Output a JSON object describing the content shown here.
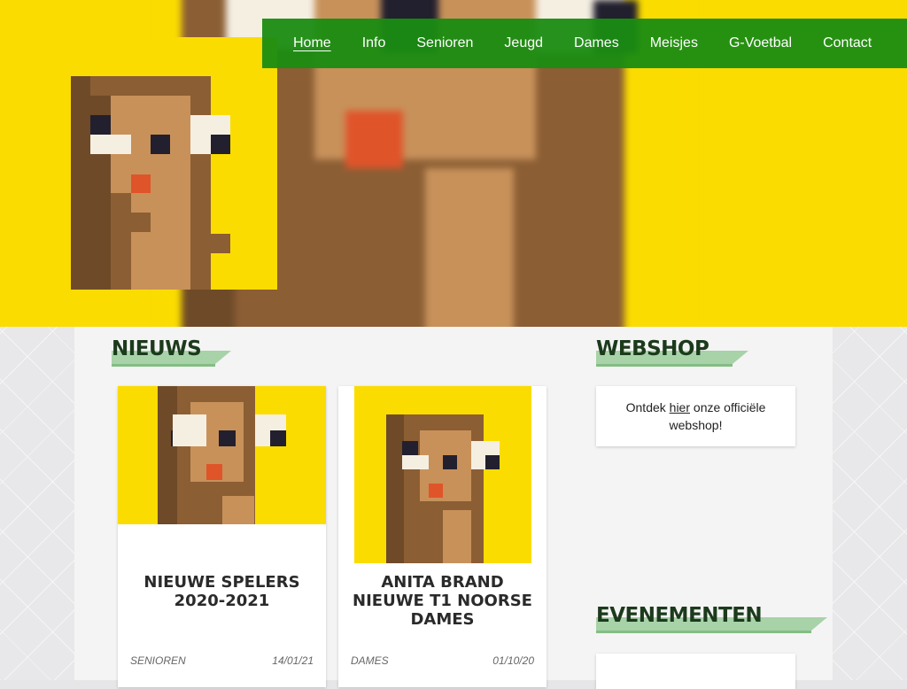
{
  "nav": {
    "items": [
      {
        "label": "Home"
      },
      {
        "label": "Info"
      },
      {
        "label": "Senioren"
      },
      {
        "label": "Jeugd"
      },
      {
        "label": "Dames"
      },
      {
        "label": "Meisjes"
      },
      {
        "label": "G-Voetbal"
      },
      {
        "label": "Contact"
      }
    ],
    "active": "Home"
  },
  "news": {
    "title": "NIEUWS",
    "articles": [
      {
        "title_line1": "NIEUWE SPELERS",
        "title_line2": "2020-2021",
        "title_line3": "",
        "category": "SENIOREN",
        "date": "14/01/21"
      },
      {
        "title_line1": "ANITA BRAND",
        "title_line2": "NIEUWE T1 NOORSE",
        "title_line3": "DAMES",
        "category": "DAMES",
        "date": "01/10/20"
      }
    ]
  },
  "webshop": {
    "title": "WEBSHOP",
    "text_before": "Ontdek",
    "link": "hier",
    "text_after": "onze officiële",
    "text_line2": "webshop!"
  },
  "events": {
    "title": "EVENEMENTEN"
  },
  "colors": {
    "brand_yellow": "#fbdc00",
    "nav_green": "#1a8c12",
    "band_green": "#a8d2a8"
  },
  "icons": {
    "logo": "squirrel-pixel-logo"
  }
}
